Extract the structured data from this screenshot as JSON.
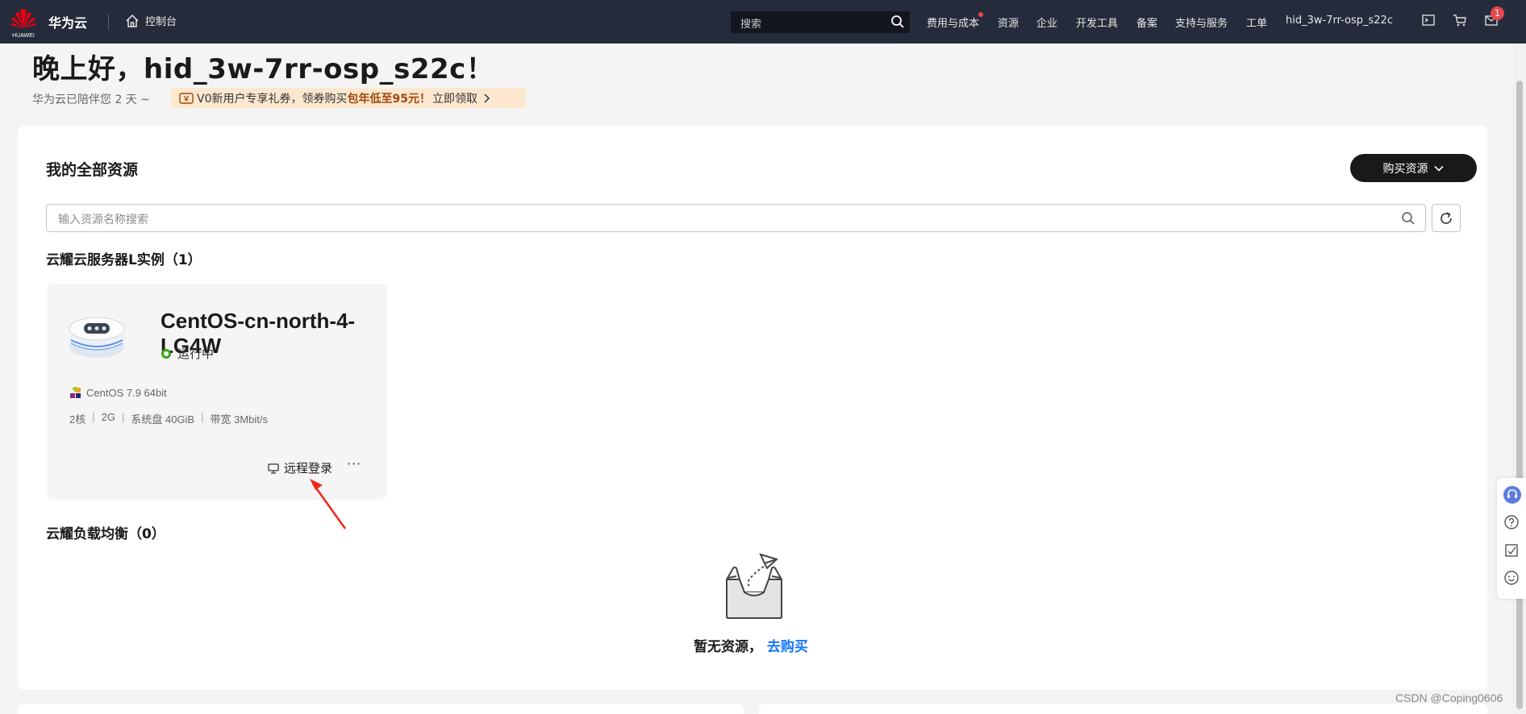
{
  "topbar": {
    "logo_text": "HUAWEI",
    "brand": "华为云",
    "console": "控制台",
    "search_placeholder": "搜索",
    "nav": [
      "费用与成本",
      "资源",
      "企业",
      "开发工具",
      "备案",
      "支持与服务",
      "工单"
    ],
    "username": "hid_3w-7rr-osp_s22c",
    "message_count": "1"
  },
  "greeting": {
    "title": "晚上好，hid_3w-7rr-osp_s22c！",
    "days": "华为云已陪伴您 2 天 ~",
    "promo_prefix": "V0新用户专享礼券，领券购买 ",
    "promo_highlight": "包年低至95元！",
    "promo_action": "立即领取"
  },
  "resources": {
    "title": "我的全部资源",
    "buy_button": "购买资源",
    "search_placeholder": "输入资源名称搜索",
    "groups": {
      "flexus_l": "云耀云服务器L实例（1）",
      "flexus_lb": "云耀负载均衡（0）"
    },
    "instance": {
      "name": "CentOS-cn-north-4-LG4W",
      "status": "运行中",
      "os": "CentOS 7.9 64bit",
      "specs": [
        "2核",
        "2G",
        "系统盘 40GiB",
        "带宽 3Mbit/s"
      ],
      "remote_login": "远程登录",
      "more": "···"
    },
    "empty": {
      "text": "暂无资源，",
      "link": "去购买"
    }
  },
  "watermark": "CSDN @Coping0606",
  "colors": {
    "topbar": "#252b3a",
    "accent_link": "#1476ff",
    "running": "#3aa51a",
    "badge": "#e5484d",
    "annotation_arrow": "#f0261c"
  }
}
